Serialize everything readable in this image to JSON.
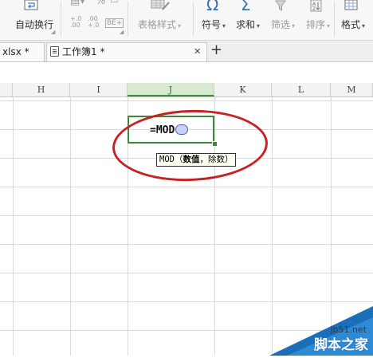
{
  "ribbon": {
    "auto_wrap_label": "自动换行",
    "percent_symbol": "%",
    "decimal_increase": "+.0\n.00",
    "decimal_decrease": ".00\n+.0",
    "table_style_label": "表格样式",
    "symbol_glyph": "Ω",
    "symbol_label": "符号",
    "sum_glyph": "Σ",
    "sum_label": "求和",
    "filter_label": "筛选",
    "sort_label": "排序",
    "format_label": "格式"
  },
  "tabs": [
    {
      "label": "xlsx *",
      "close": "✕"
    },
    {
      "label": "工作簿1 *",
      "close": "✕"
    }
  ],
  "new_tab": "+",
  "columns": [
    "H",
    "I",
    "J",
    "K",
    "L",
    "M"
  ],
  "active_column": "J",
  "cell": {
    "content": "=MOD"
  },
  "tooltip": {
    "fn": "MOD",
    "open": "（",
    "arg1": "数值",
    "sep": "，",
    "arg2": "除数",
    "close": "）"
  },
  "watermark": {
    "line1": "jb51.net",
    "line2": "脚本之家"
  },
  "colors": {
    "accent_green": "#3b8a3b",
    "annotation_red": "#c62424",
    "watermark_blue": "#1b6fb8"
  }
}
